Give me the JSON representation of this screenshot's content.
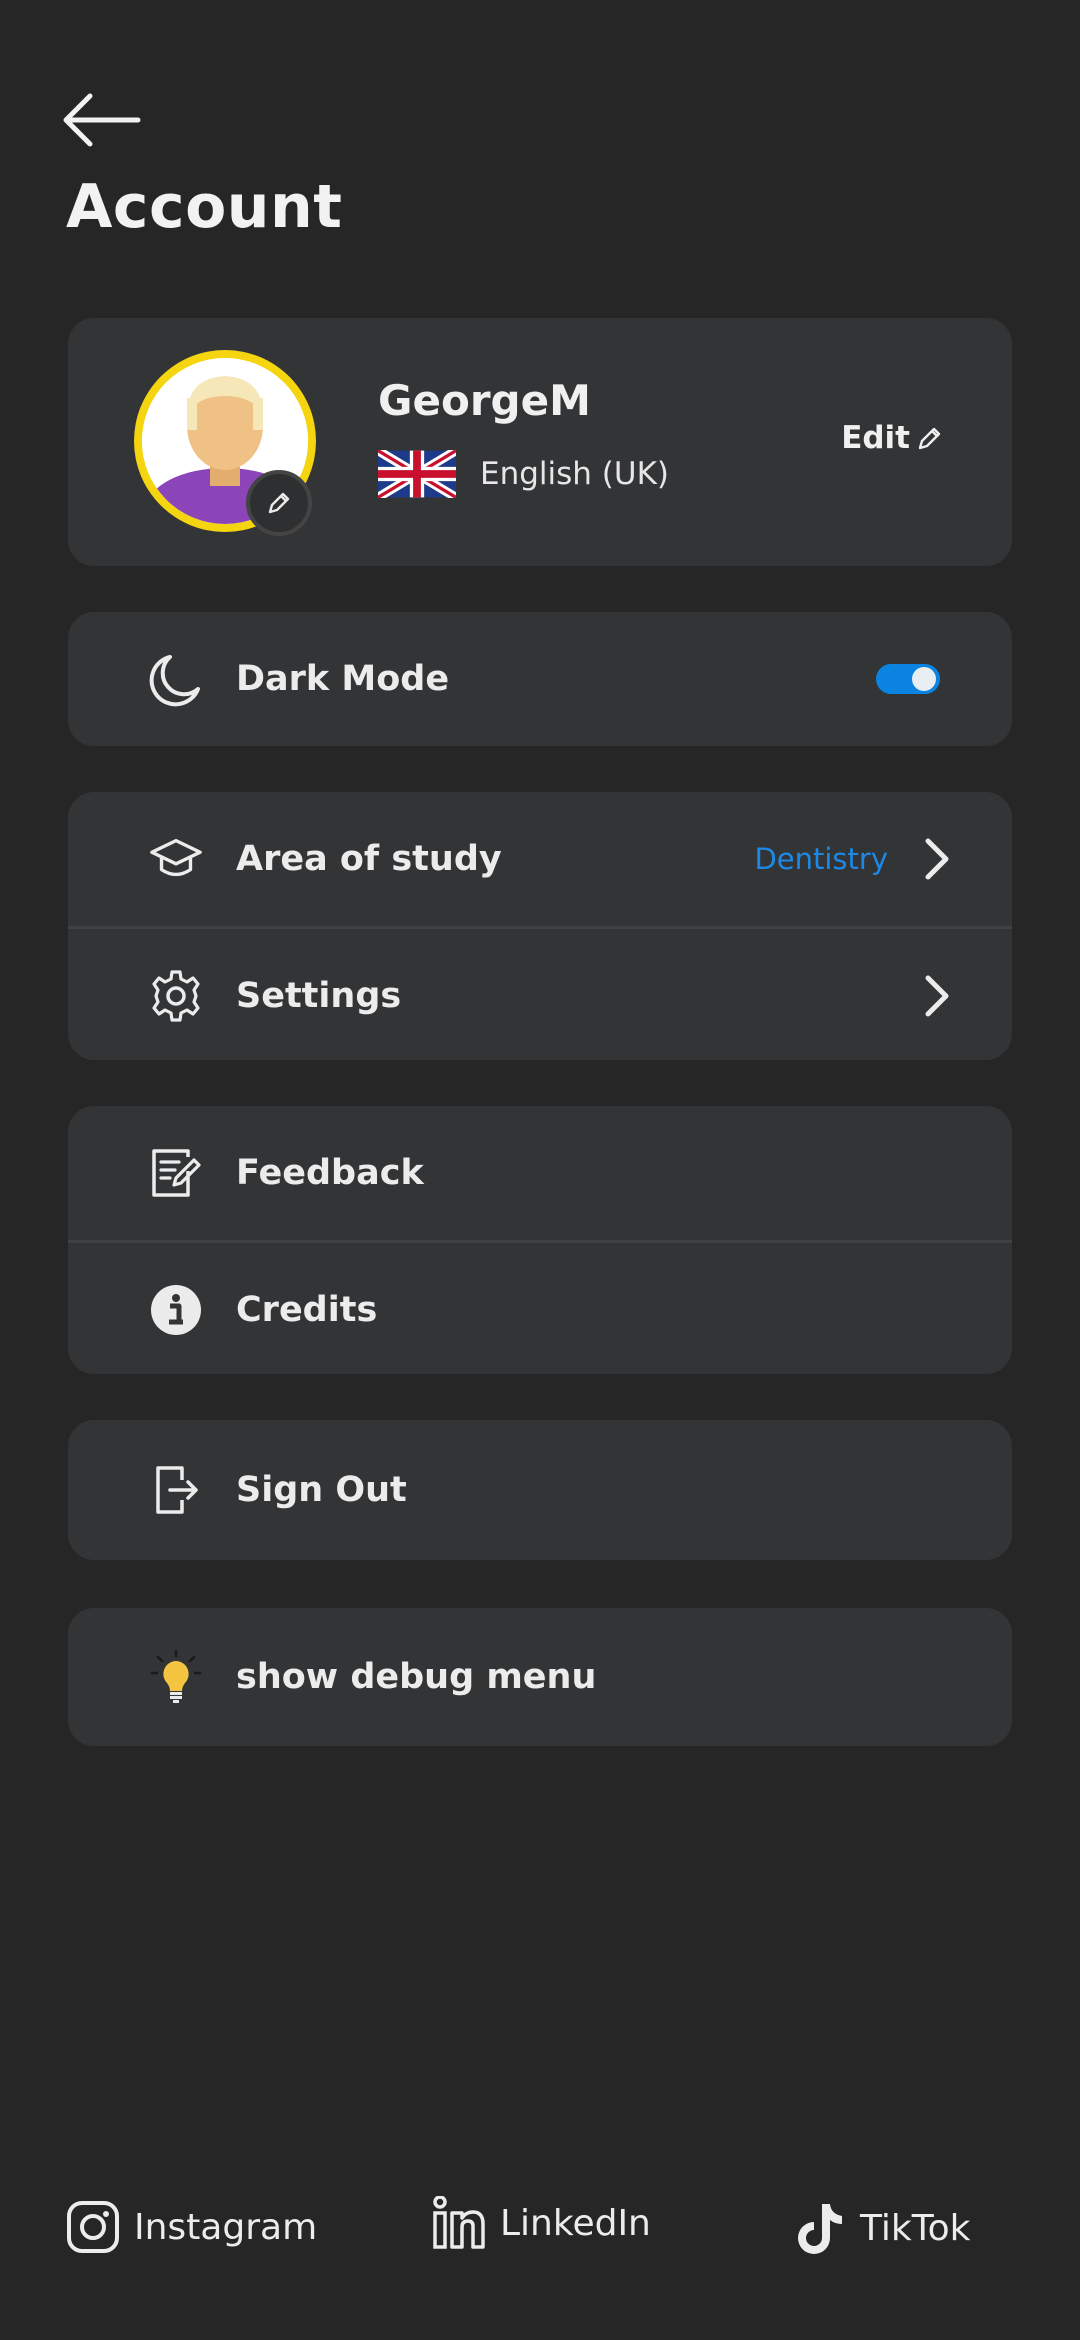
{
  "header": {
    "title": "Account"
  },
  "profile": {
    "username": "GeorgeM",
    "language": "English (UK)",
    "edit_label": "Edit"
  },
  "dark_mode": {
    "label": "Dark Mode",
    "enabled": true,
    "accent": "#0a84e0"
  },
  "menu": {
    "area_of_study": {
      "label": "Area of study",
      "value": "Dentistry"
    },
    "settings": {
      "label": "Settings"
    },
    "feedback": {
      "label": "Feedback"
    },
    "credits": {
      "label": "Credits"
    },
    "sign_out": {
      "label": "Sign Out"
    },
    "debug": {
      "label": "show debug menu"
    }
  },
  "footer": {
    "instagram": "Instagram",
    "linkedin": "LinkedIn",
    "tiktok": "TikTok"
  },
  "colors": {
    "background": "#262626",
    "card": "#323436",
    "link": "#1e88e5",
    "avatar_ring": "#f5d510"
  }
}
